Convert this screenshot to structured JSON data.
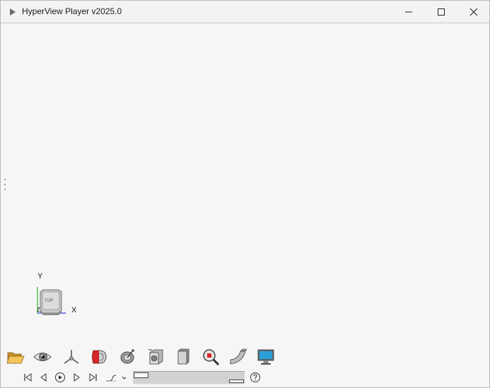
{
  "window": {
    "title": "HyperView Player v2025.0"
  },
  "triad": {
    "y_label": "Y",
    "x_label": "X",
    "z_label": "Z",
    "cube_face": "TOP"
  },
  "toolbar": {
    "tools": [
      "folder-open-icon",
      "eye-icon",
      "triad-axes-icon",
      "reverse-model-icon",
      "satellite-view-icon",
      "view-cube-icon",
      "solid-box-icon",
      "zoom-icon",
      "curved-shape-icon",
      "monitor-icon"
    ]
  },
  "colors": {
    "titlebar": "#f3f3f3",
    "viewport": "#f6f6f6",
    "axis_y": "#2fb52f",
    "axis_x": "#2b3bd6",
    "tool_red": "#d6262a"
  }
}
